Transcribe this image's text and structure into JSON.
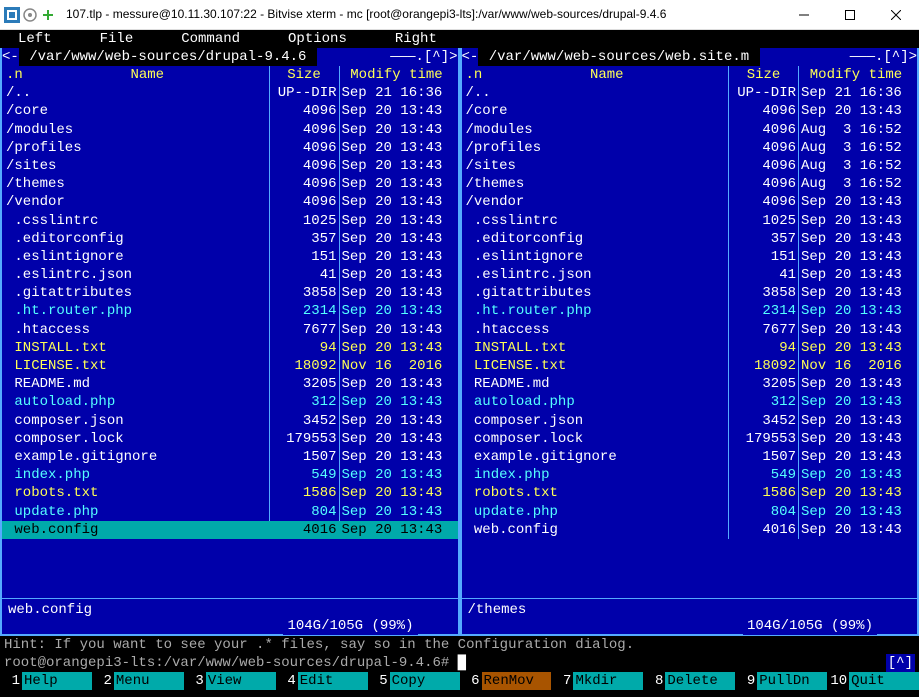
{
  "window": {
    "title": "107.tlp - messure@10.11.30.107:22 - Bitvise xterm - mc [root@orangepi3-lts]:/var/www/web-sources/drupal-9.4.6"
  },
  "menu": {
    "left": "Left",
    "file": "File",
    "command": "Command",
    "options": "Options",
    "right": "Right"
  },
  "left_panel": {
    "path_prefix": "<-",
    "path": " /var/www/web-sources/drupal-9.4.6 ",
    "path_suffix": "———.[^]>",
    "cols": {
      "n": ".n",
      "name": "Name",
      "size": "Size",
      "modify": "Modify time"
    },
    "files": [
      {
        "name": "/..",
        "size": "UP--DIR",
        "mod": "Sep 21 16:36",
        "cls": "dir"
      },
      {
        "name": "/core",
        "size": "4096",
        "mod": "Sep 20 13:43",
        "cls": "dir"
      },
      {
        "name": "/modules",
        "size": "4096",
        "mod": "Sep 20 13:43",
        "cls": "dir"
      },
      {
        "name": "/profiles",
        "size": "4096",
        "mod": "Sep 20 13:43",
        "cls": "dir"
      },
      {
        "name": "/sites",
        "size": "4096",
        "mod": "Sep 20 13:43",
        "cls": "dir"
      },
      {
        "name": "/themes",
        "size": "4096",
        "mod": "Sep 20 13:43",
        "cls": "dir"
      },
      {
        "name": "/vendor",
        "size": "4096",
        "mod": "Sep 20 13:43",
        "cls": "dir"
      },
      {
        "name": " .csslintrc",
        "size": "1025",
        "mod": "Sep 20 13:43",
        "cls": ""
      },
      {
        "name": " .editorconfig",
        "size": "357",
        "mod": "Sep 20 13:43",
        "cls": ""
      },
      {
        "name": " .eslintignore",
        "size": "151",
        "mod": "Sep 20 13:43",
        "cls": ""
      },
      {
        "name": " .eslintrc.json",
        "size": "41",
        "mod": "Sep 20 13:43",
        "cls": ""
      },
      {
        "name": " .gitattributes",
        "size": "3858",
        "mod": "Sep 20 13:43",
        "cls": ""
      },
      {
        "name": " .ht.router.php",
        "size": "2314",
        "mod": "Sep 20 13:43",
        "cls": "link"
      },
      {
        "name": " .htaccess",
        "size": "7677",
        "mod": "Sep 20 13:43",
        "cls": ""
      },
      {
        "name": " INSTALL.txt",
        "size": "94",
        "mod": "Sep 20 13:43",
        "cls": "yellow"
      },
      {
        "name": " LICENSE.txt",
        "size": "18092",
        "mod": "Nov 16  2016",
        "cls": "yellow"
      },
      {
        "name": " README.md",
        "size": "3205",
        "mod": "Sep 20 13:43",
        "cls": ""
      },
      {
        "name": " autoload.php",
        "size": "312",
        "mod": "Sep 20 13:43",
        "cls": "link"
      },
      {
        "name": " composer.json",
        "size": "3452",
        "mod": "Sep 20 13:43",
        "cls": ""
      },
      {
        "name": " composer.lock",
        "size": "179553",
        "mod": "Sep 20 13:43",
        "cls": ""
      },
      {
        "name": " example.gitignore",
        "size": "1507",
        "mod": "Sep 20 13:43",
        "cls": ""
      },
      {
        "name": " index.php",
        "size": "549",
        "mod": "Sep 20 13:43",
        "cls": "link"
      },
      {
        "name": " robots.txt",
        "size": "1586",
        "mod": "Sep 20 13:43",
        "cls": "yellow"
      },
      {
        "name": " update.php",
        "size": "804",
        "mod": "Sep 20 13:43",
        "cls": "link"
      },
      {
        "name": " web.config",
        "size": "4016",
        "mod": "Sep 20 13:43",
        "cls": "selected"
      }
    ],
    "footer": "web.config",
    "stats": "104G/105G (99%)"
  },
  "right_panel": {
    "path_prefix": "<-",
    "path": " /var/www/web-sources/web.site.m ",
    "path_suffix": "———.[^]>",
    "cols": {
      "n": ".n",
      "name": "Name",
      "size": "Size",
      "modify": "Modify time"
    },
    "files": [
      {
        "name": "/..",
        "size": "UP--DIR",
        "mod": "Sep 21 16:36",
        "cls": "dir"
      },
      {
        "name": "/core",
        "size": "4096",
        "mod": "Sep 20 13:43",
        "cls": "dir"
      },
      {
        "name": "/modules",
        "size": "4096",
        "mod": "Aug  3 16:52",
        "cls": "dir"
      },
      {
        "name": "/profiles",
        "size": "4096",
        "mod": "Aug  3 16:52",
        "cls": "dir"
      },
      {
        "name": "/sites",
        "size": "4096",
        "mod": "Aug  3 16:52",
        "cls": "dir"
      },
      {
        "name": "/themes",
        "size": "4096",
        "mod": "Aug  3 16:52",
        "cls": "dir"
      },
      {
        "name": "/vendor",
        "size": "4096",
        "mod": "Sep 20 13:43",
        "cls": "dir"
      },
      {
        "name": " .csslintrc",
        "size": "1025",
        "mod": "Sep 20 13:43",
        "cls": ""
      },
      {
        "name": " .editorconfig",
        "size": "357",
        "mod": "Sep 20 13:43",
        "cls": ""
      },
      {
        "name": " .eslintignore",
        "size": "151",
        "mod": "Sep 20 13:43",
        "cls": ""
      },
      {
        "name": " .eslintrc.json",
        "size": "41",
        "mod": "Sep 20 13:43",
        "cls": ""
      },
      {
        "name": " .gitattributes",
        "size": "3858",
        "mod": "Sep 20 13:43",
        "cls": ""
      },
      {
        "name": " .ht.router.php",
        "size": "2314",
        "mod": "Sep 20 13:43",
        "cls": "link"
      },
      {
        "name": " .htaccess",
        "size": "7677",
        "mod": "Sep 20 13:43",
        "cls": ""
      },
      {
        "name": " INSTALL.txt",
        "size": "94",
        "mod": "Sep 20 13:43",
        "cls": "yellow"
      },
      {
        "name": " LICENSE.txt",
        "size": "18092",
        "mod": "Nov 16  2016",
        "cls": "yellow"
      },
      {
        "name": " README.md",
        "size": "3205",
        "mod": "Sep 20 13:43",
        "cls": ""
      },
      {
        "name": " autoload.php",
        "size": "312",
        "mod": "Sep 20 13:43",
        "cls": "link"
      },
      {
        "name": " composer.json",
        "size": "3452",
        "mod": "Sep 20 13:43",
        "cls": ""
      },
      {
        "name": " composer.lock",
        "size": "179553",
        "mod": "Sep 20 13:43",
        "cls": ""
      },
      {
        "name": " example.gitignore",
        "size": "1507",
        "mod": "Sep 20 13:43",
        "cls": ""
      },
      {
        "name": " index.php",
        "size": "549",
        "mod": "Sep 20 13:43",
        "cls": "link"
      },
      {
        "name": " robots.txt",
        "size": "1586",
        "mod": "Sep 20 13:43",
        "cls": "yellow"
      },
      {
        "name": " update.php",
        "size": "804",
        "mod": "Sep 20 13:43",
        "cls": "link"
      },
      {
        "name": " web.config",
        "size": "4016",
        "mod": "Sep 20 13:43",
        "cls": ""
      }
    ],
    "footer": "/themes",
    "stats": "104G/105G (99%)"
  },
  "hint": "Hint: If you want to see your .* files, say so in the Configuration dialog.",
  "prompt": "root@orangepi3-lts:/var/www/web-sources/drupal-9.4.6#",
  "scroll_ind": "[^]",
  "fkeys": [
    {
      "n": "1",
      "l": "Help"
    },
    {
      "n": "2",
      "l": "Menu"
    },
    {
      "n": "3",
      "l": "View"
    },
    {
      "n": "4",
      "l": "Edit"
    },
    {
      "n": "5",
      "l": "Copy"
    },
    {
      "n": "6",
      "l": "RenMov",
      "hl": true
    },
    {
      "n": "7",
      "l": "Mkdir"
    },
    {
      "n": "8",
      "l": "Delete"
    },
    {
      "n": "9",
      "l": "PullDn"
    },
    {
      "n": "10",
      "l": "Quit"
    }
  ]
}
